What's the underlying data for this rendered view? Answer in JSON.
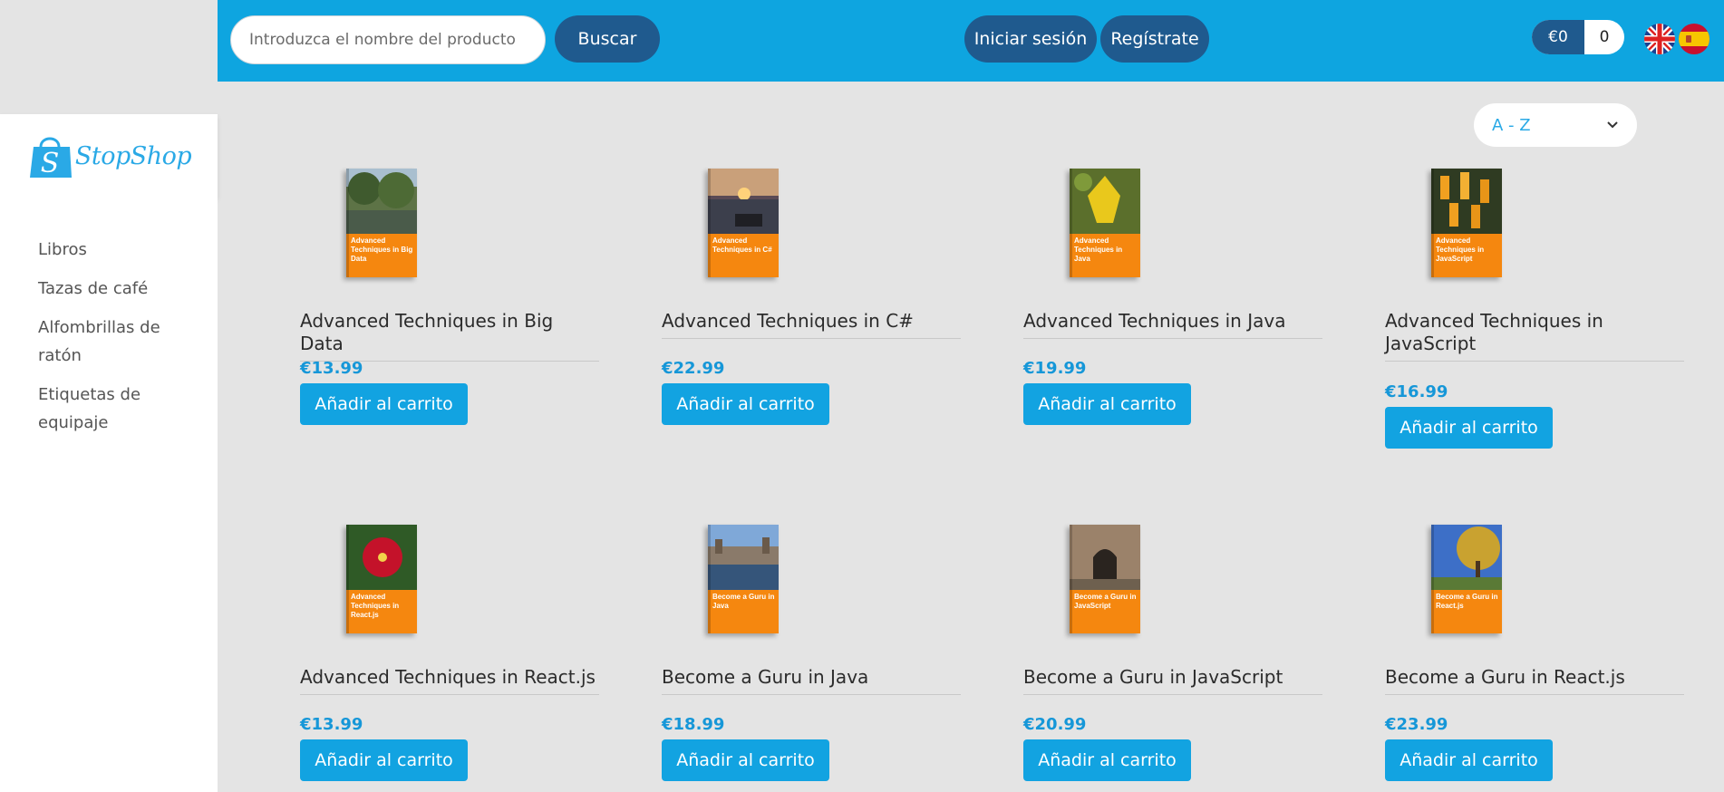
{
  "header": {
    "search_placeholder": "Introduzca el nombre del producto",
    "search_button": "Buscar",
    "login_button": "Iniciar sesión",
    "register_button": "Regístrate",
    "cart_total": "€0",
    "cart_count": "0"
  },
  "brand": {
    "logo_text": "StopShop"
  },
  "sidebar": {
    "items": [
      {
        "label": "Libros"
      },
      {
        "label": "Tazas de café"
      },
      {
        "label": "Alfombrillas de ratón"
      },
      {
        "label": "Etiquetas de equipaje"
      }
    ]
  },
  "sort": {
    "selected": "A - Z"
  },
  "products": [
    {
      "title": "Advanced Techniques in Big Data",
      "price": "€13.99",
      "button": "Añadir al carrito",
      "cover_text": "Advanced Techniques in Big Data"
    },
    {
      "title": "Advanced Techniques in C#",
      "price": "€22.99",
      "button": "Añadir al carrito",
      "cover_text": "Advanced Techniques in C#"
    },
    {
      "title": "Advanced Techniques in Java",
      "price": "€19.99",
      "button": "Añadir al carrito",
      "cover_text": "Advanced Techniques in Java"
    },
    {
      "title": "Advanced Techniques in JavaScript",
      "price": "€16.99",
      "button": "Añadir al carrito",
      "cover_text": "Advanced Techniques in JavaScript"
    },
    {
      "title": "Advanced Techniques in React.js",
      "price": "€13.99",
      "button": "Añadir al carrito",
      "cover_text": "Advanced Techniques in React.js"
    },
    {
      "title": "Become a Guru in Java",
      "price": "€18.99",
      "button": "Añadir al carrito",
      "cover_text": "Become a Guru in Java"
    },
    {
      "title": "Become a Guru in JavaScript",
      "price": "€20.99",
      "button": "Añadir al carrito",
      "cover_text": "Become a Guru in JavaScript"
    },
    {
      "title": "Become a Guru in React.js",
      "price": "€23.99",
      "button": "Añadir al carrito",
      "cover_text": "Become a Guru in React.js"
    }
  ]
}
